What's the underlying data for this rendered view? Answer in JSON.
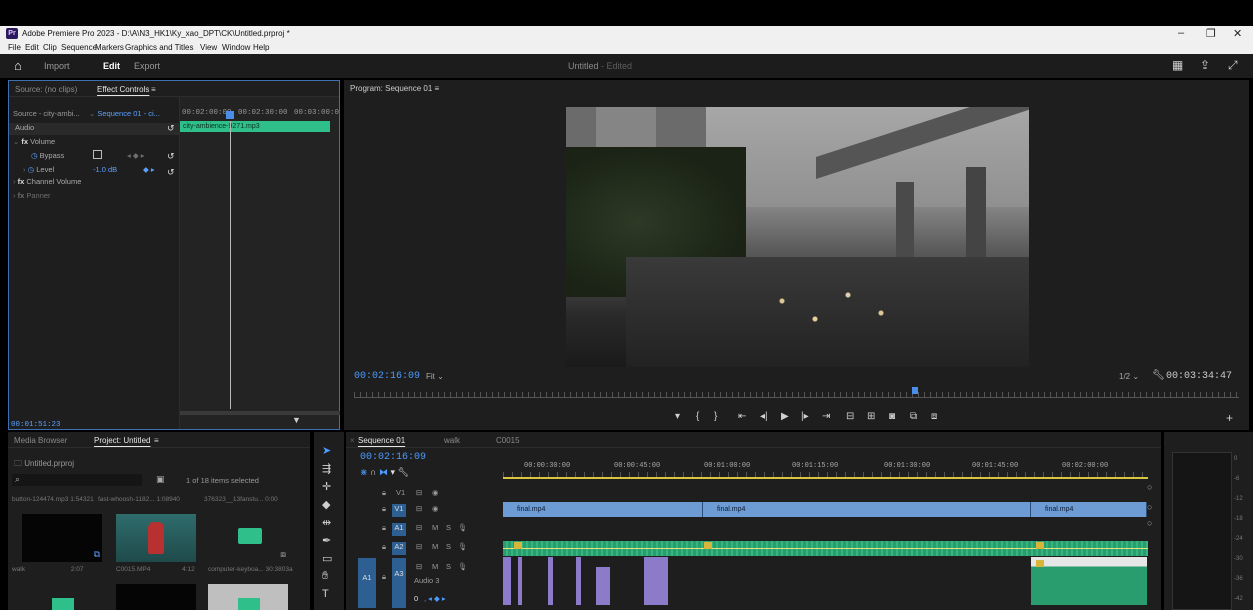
{
  "window": {
    "title": "Adobe Premiere Pro 2023 - D:\\A\\N3_HK1\\Ky_xao_DPT\\CK\\Untitled.prproj *",
    "app_badge": "Pr",
    "minimize": "–",
    "restore": "❐",
    "close": "✕"
  },
  "menu": [
    "File",
    "Edit",
    "Clip",
    "Sequence",
    "Markers",
    "Graphics and Titles",
    "View",
    "Window",
    "Help"
  ],
  "header": {
    "nav": [
      "Import",
      "Edit",
      "Export"
    ],
    "active": "Edit",
    "document_title": "Untitled",
    "document_status": " - Edited"
  },
  "effect_controls": {
    "tab_source": "Source: (no clips)",
    "tab_effect": "Effect Controls",
    "menu_icon": "≡",
    "source_label": "Source - city-ambi...",
    "sequence_label": "Sequence 01 - ci...",
    "ruler": [
      "00:02:00:00",
      "00:02:30:00",
      "00:03:00:0"
    ],
    "section": "Audio",
    "clip_name": "city-ambience-9271.mp3",
    "rows": [
      {
        "label": "Volume",
        "type": "fx"
      },
      {
        "label": "Bypass",
        "type": "param"
      },
      {
        "label": "Level",
        "type": "param",
        "value": "-1.0 dB"
      },
      {
        "label": "Channel Volume",
        "type": "fx"
      },
      {
        "label": "Panner",
        "type": "fx-dim"
      }
    ],
    "timecode": "00:01:51:23"
  },
  "program": {
    "title": "Program: Sequence 01",
    "menu_icon": "≡",
    "timecode": "00:02:16:09",
    "fit": "Fit",
    "resolution": "1/2",
    "duration": "00:03:34:47"
  },
  "project": {
    "tab_media": "Media Browser",
    "tab_project": "Project: Untitled",
    "menu_icon": "≡",
    "file": "Untitled.prproj",
    "selection": "1 of 18 items selected",
    "search_icon": "⌕",
    "top_items": [
      {
        "name": "button-124474.mp3",
        "dur": "1:54321"
      },
      {
        "name": "fast-whoosh-1182...",
        "dur": "1:08940"
      },
      {
        "name": "376323__13fanstu...",
        "dur": "0:00"
      }
    ],
    "bottom_items": [
      {
        "name": "walk",
        "dur": "2:07"
      },
      {
        "name": "C0015.MP4",
        "dur": "4:12"
      },
      {
        "name": "computer-keyboa...",
        "dur": "30:3803a"
      }
    ]
  },
  "timeline": {
    "tabs": [
      "Sequence 01",
      "walk",
      "C0015"
    ],
    "timecode": "00:02:16:09",
    "ruler": [
      "00:00:30:00",
      "00:00:45:00",
      "00:01:00:00",
      "00:01:15:00",
      "00:01:30:00",
      "00:01:45:00",
      "00:02:00:00"
    ],
    "tracks": [
      {
        "name": "V1",
        "kind": "video-empty"
      },
      {
        "name": "V1",
        "kind": "video"
      },
      {
        "name": "A1",
        "kind": "audio"
      },
      {
        "name": "A2",
        "kind": "audio"
      },
      {
        "name": "A3",
        "kind": "audio",
        "label": "Audio 3"
      }
    ],
    "video_clips": [
      "final.mp4",
      "final.mp4",
      "final.mp4"
    ],
    "mute": "M",
    "solo": "S",
    "audio_zoom": "0"
  },
  "meter": {
    "scale": [
      "0",
      "-6",
      "-12",
      "-18",
      "-24",
      "-30",
      "-36",
      "-42"
    ]
  },
  "colors": {
    "accent": "#3f6fb3",
    "audio_clip": "#2fbf8a",
    "video_clip": "#6d9bd4",
    "playhead": "#4b8ee8"
  }
}
